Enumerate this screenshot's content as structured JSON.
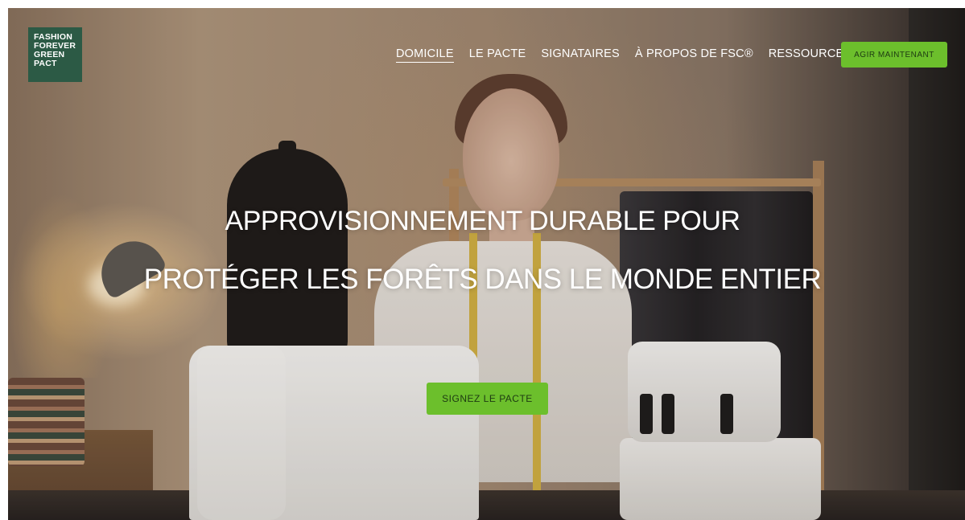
{
  "brand": {
    "logo_lines": [
      "FASHION",
      "FOREVER",
      "GREEN",
      "PACT"
    ],
    "logo_color": "#2c5a45"
  },
  "nav": {
    "items": [
      {
        "label": "DOMICILE",
        "active": true
      },
      {
        "label": "LE PACTE",
        "active": false
      },
      {
        "label": "SIGNATAIRES",
        "active": false
      },
      {
        "label": "À PROPOS DE FSC®",
        "active": false
      },
      {
        "label": "RESSOURCES",
        "active": false
      }
    ],
    "cta_label": "AGIR MAINTENANT"
  },
  "hero": {
    "title_line_1": "APPROVISIONNEMENT DURABLE POUR",
    "title_line_2": "PROTÉGER LES FORÊTS DANS LE MONDE ENTIER",
    "cta_label": "SIGNEZ LE PACTE",
    "background": "seamstress-with-sewing-machines"
  },
  "colors": {
    "accent_green": "#6cbf2c",
    "button_text": "#1d3a12",
    "nav_text": "#ffffff"
  }
}
